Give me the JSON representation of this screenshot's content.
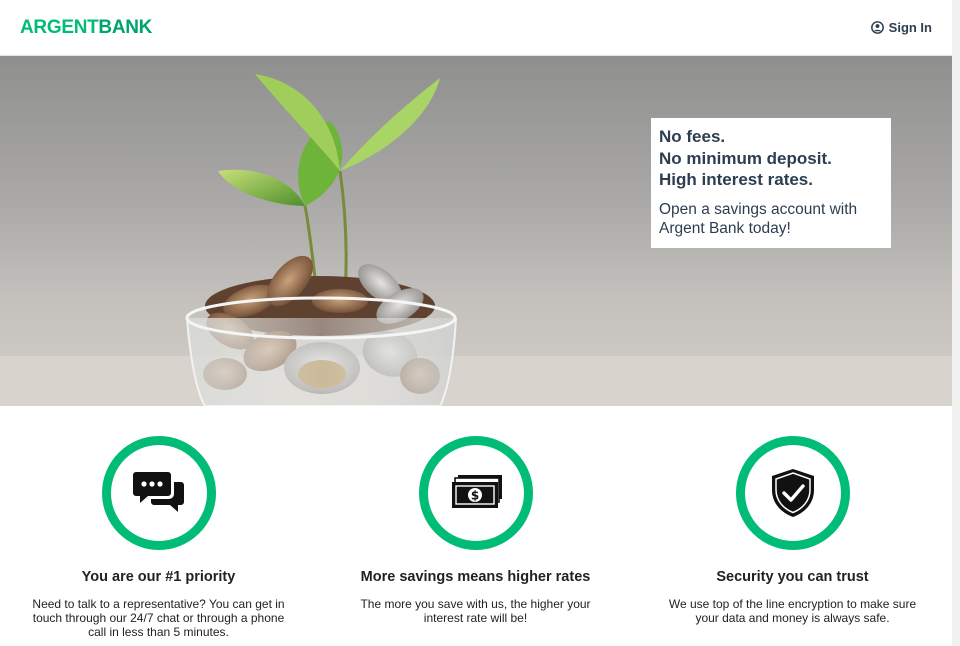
{
  "header": {
    "logo_part1": "ARGENT",
    "logo_part2": "BANK",
    "sign_in_label": "Sign In"
  },
  "hero": {
    "subtitles": [
      "No fees.",
      "No minimum deposit.",
      "High interest rates."
    ],
    "text": "Open a savings account with Argent Bank today!"
  },
  "features": [
    {
      "icon": "chat-icon",
      "title": "You are our #1 priority",
      "text": "Need to talk to a representative? You can get in touch through our 24/7 chat or through a phone call in less than 5 minutes."
    },
    {
      "icon": "money-icon",
      "title": "More savings means higher rates",
      "text": "The more you save with us, the higher your interest rate will be!"
    },
    {
      "icon": "security-icon",
      "title": "Security you can trust",
      "text": "We use top of the line encryption to make sure your data and money is always safe."
    }
  ],
  "colors": {
    "accent": "#00bc77",
    "text": "#2c3e50"
  }
}
